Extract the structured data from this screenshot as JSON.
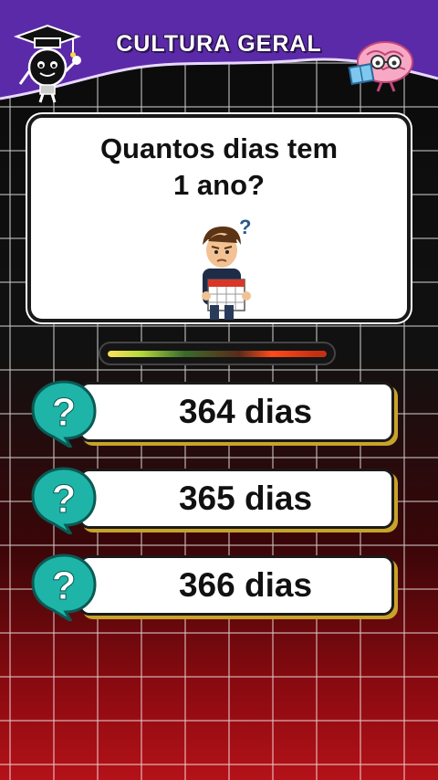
{
  "header": {
    "title": "CULTURA GERAL"
  },
  "question": {
    "line1": "Quantos dias tem",
    "line2": "1 ano?"
  },
  "timer": {
    "progress": 1.0
  },
  "options": [
    {
      "label": "364 dias"
    },
    {
      "label": "365 dias"
    },
    {
      "label": "366 dias"
    }
  ],
  "colors": {
    "header_purple": "#5b2aa8",
    "bubble_teal": "#1fb4a8",
    "option_shadow": "#c9a22a",
    "bottom_red": "#b31218"
  },
  "icons": {
    "left_mascot": "graduation-lightbulb-icon",
    "right_mascot": "brain-reading-icon",
    "question_illustration": "boy-with-calendar-icon",
    "option_icon": "question-bubble-icon"
  }
}
